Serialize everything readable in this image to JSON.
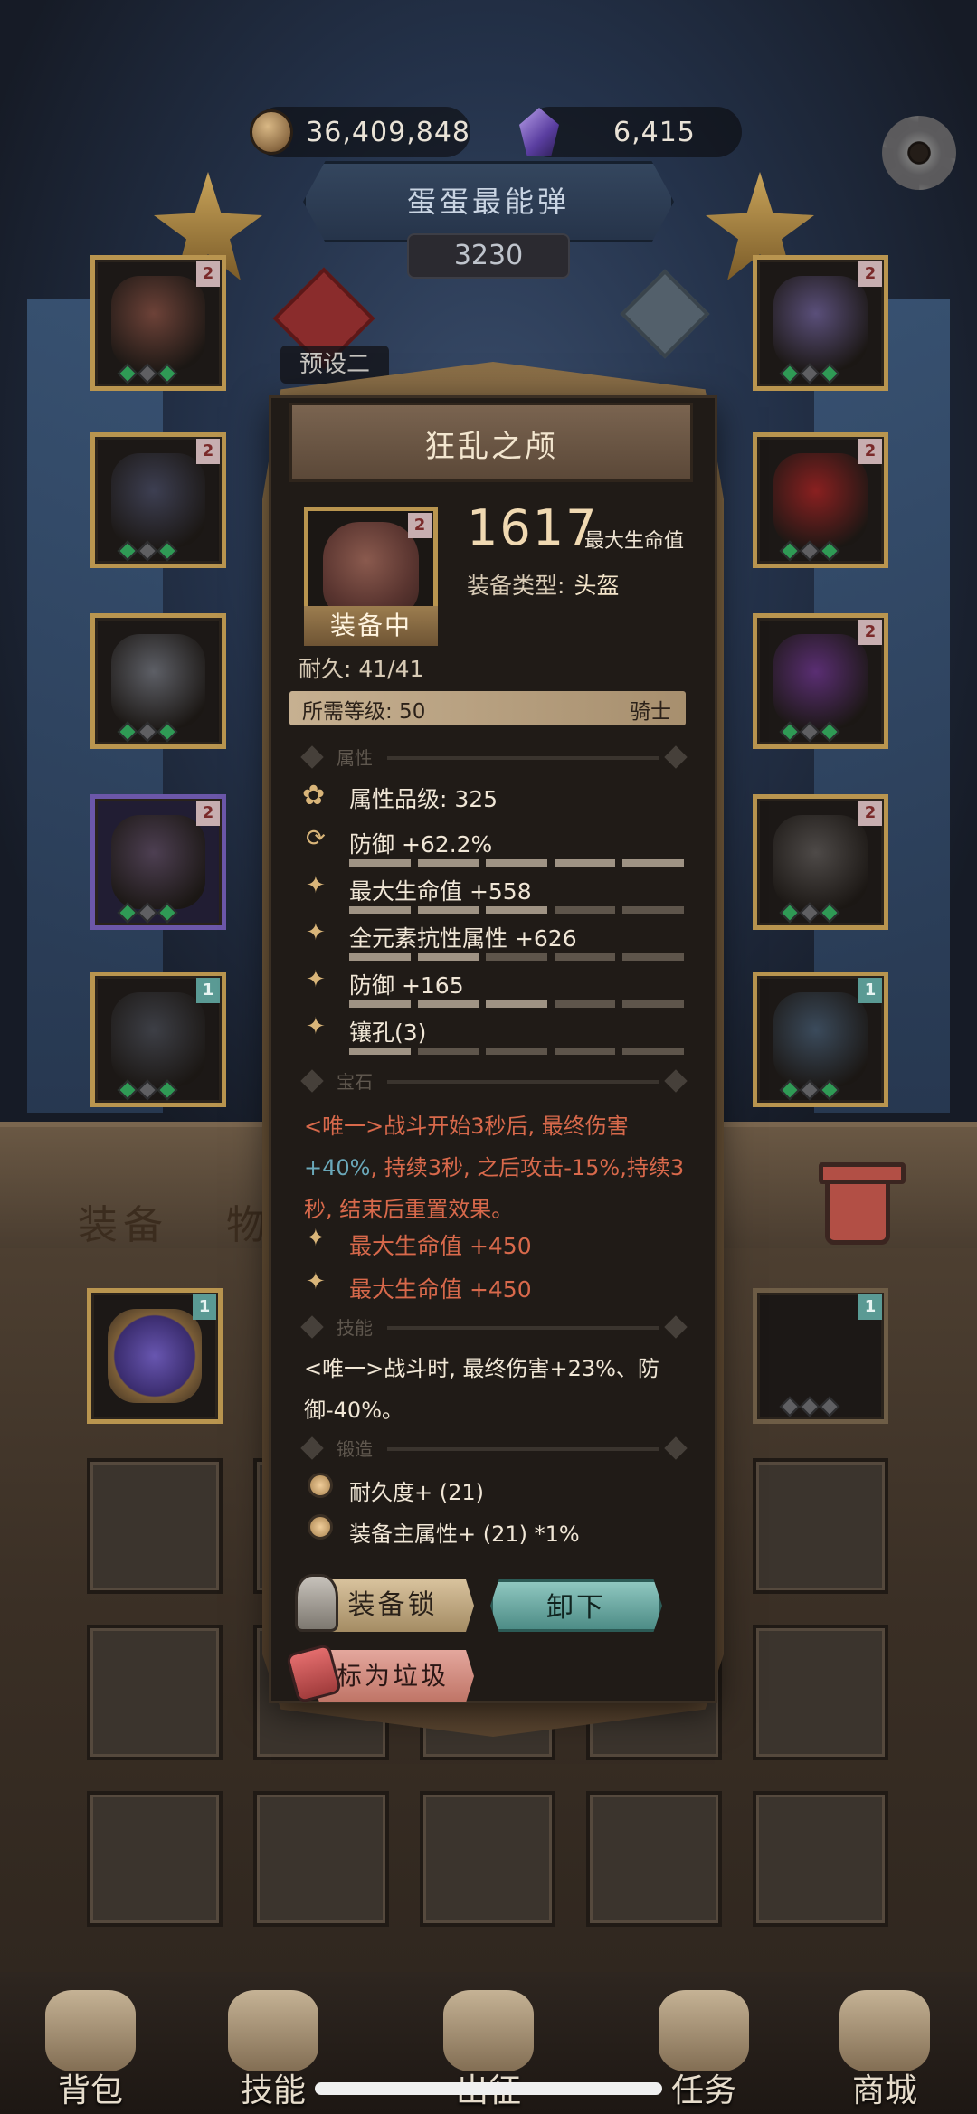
{
  "currency": {
    "coins": "36,409,848",
    "gems": "6,415"
  },
  "banner": {
    "title": "蛋蛋最能弹",
    "power": "3230"
  },
  "preset": {
    "label": "预设二"
  },
  "equip_slots": {
    "left": [
      {
        "name": "helmet",
        "badge": "2",
        "color": "#6d4238"
      },
      {
        "name": "armor",
        "badge": "2",
        "color": "#3d3f52"
      },
      {
        "name": "gauntlet",
        "badge": "",
        "color": "#5d5f66"
      },
      {
        "name": "legs",
        "badge": "2",
        "color": "#4d3f52"
      },
      {
        "name": "boots",
        "badge": "1",
        "color": "#3d3f46"
      }
    ],
    "right": [
      {
        "name": "amulet",
        "badge": "2",
        "color": "#5a4f7a"
      },
      {
        "name": "ring",
        "badge": "2",
        "color": "#8a2020"
      },
      {
        "name": "shield",
        "badge": "2",
        "color": "#5a2e73"
      },
      {
        "name": "weapon",
        "badge": "2",
        "color": "#4e4a48"
      },
      {
        "name": "relic",
        "badge": "1",
        "color": "#3b4b5c"
      }
    ]
  },
  "bag": {
    "tab_equipment": "装备",
    "tab_items": "物"
  },
  "item": {
    "title": "狂乱之颅",
    "badge": "2",
    "equipped": "装备中",
    "value": "1617",
    "value_unit": "最大生命值",
    "type_label": "装备类型:",
    "type_value": "头盔",
    "durability": "耐久: 41/41",
    "req_level": "所需等级: 50",
    "req_class": "骑士",
    "sections": {
      "attributes": "属性",
      "gems": "宝石",
      "skills": "技能",
      "forge": "锻造"
    },
    "quality": "属性品级: 325",
    "stats": [
      {
        "text": "防御 +62.2%",
        "fill": 0.9
      },
      {
        "text": "最大生命值 +558",
        "fill": 0.6
      },
      {
        "text": "全元素抗性属性 +626",
        "fill": 0.45
      },
      {
        "text": "防御 +165",
        "fill": 0.5
      },
      {
        "text": "镶孔(3)",
        "fill": 0.2
      }
    ],
    "gem_effect_a": "<唯一>战斗开始3秒后, 最终伤害",
    "gem_effect_b": "+40%",
    "gem_effect_c": ", 持续3秒, 之后攻击-15%,持续3秒, 结束后重置效果。",
    "gem_stats": [
      "最大生命值 +450",
      "最大生命值 +450"
    ],
    "skill": "<唯一>战斗时, 最终伤害+23%、防御-40%。",
    "forge": [
      "耐久度+ (21)",
      "装备主属性+ (21) *1%"
    ],
    "buttons": {
      "lock": "装备锁",
      "unequip": "卸下",
      "trash": "标为垃圾"
    }
  },
  "nav": {
    "bag": "背包",
    "skills": "技能",
    "expedition": "出征",
    "tasks": "任务",
    "shop": "商城"
  }
}
